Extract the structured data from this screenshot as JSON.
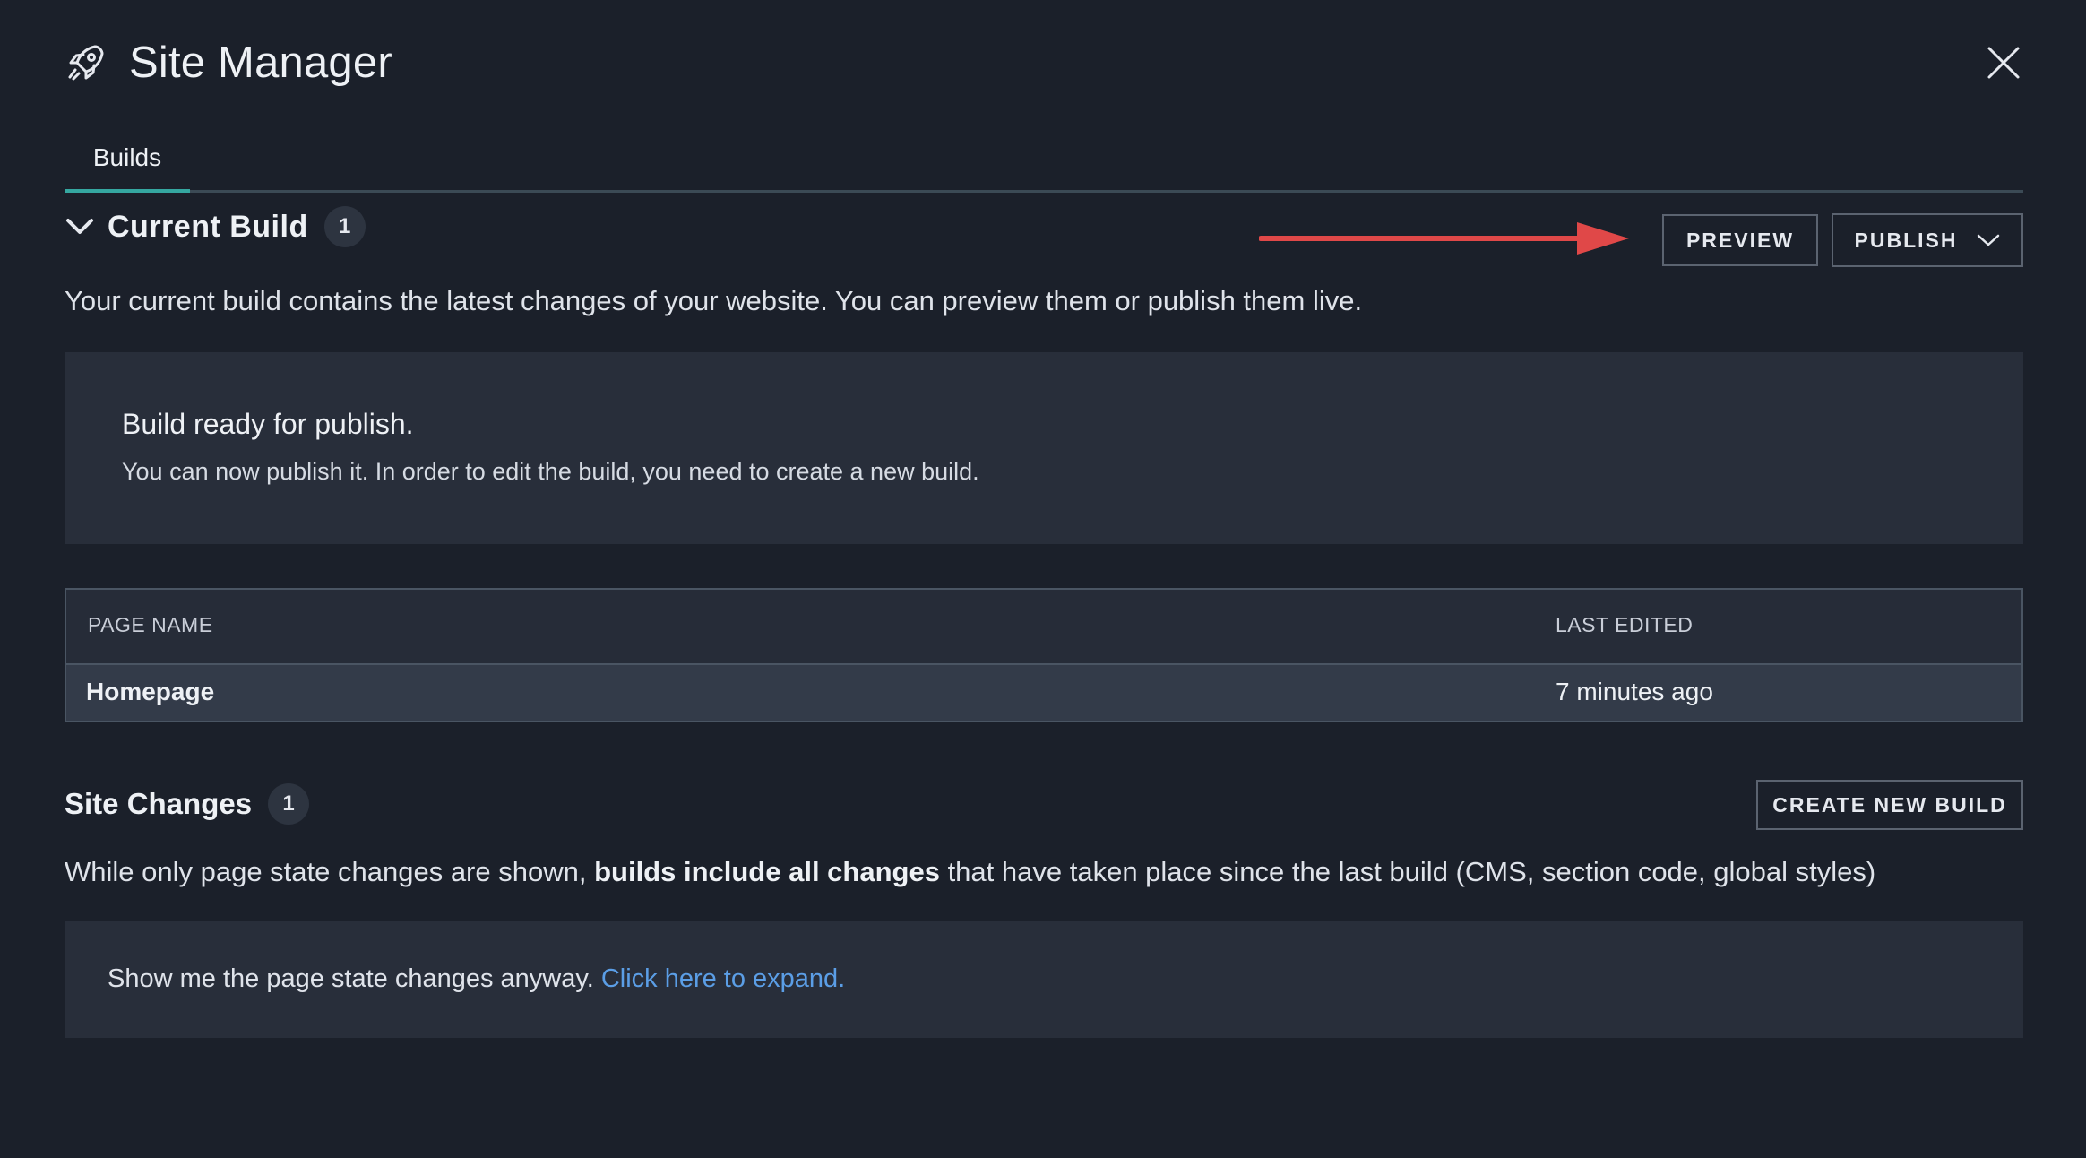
{
  "window": {
    "title": "Site Manager",
    "icon": "rocket-icon"
  },
  "tabs": [
    {
      "label": "Builds",
      "active": true
    }
  ],
  "current_build": {
    "title": "Current Build",
    "count": "1",
    "preview_label": "PREVIEW",
    "publish_label": "PUBLISH",
    "description": "Your current build contains the latest changes of your website. You can preview them or publish them live.",
    "status_card": {
      "title": "Build ready for publish.",
      "message": "You can now publish it. In order to edit the build, you need to create a new build."
    },
    "table": {
      "columns": [
        "PAGE NAME",
        "LAST EDITED"
      ],
      "rows": [
        {
          "page_name": "Homepage",
          "last_edited": "7 minutes ago"
        }
      ]
    }
  },
  "site_changes": {
    "title": "Site Changes",
    "count": "1",
    "create_label": "CREATE NEW BUILD",
    "description_pre": "While only page state changes are shown, ",
    "description_bold": "builds include all changes",
    "description_post": " that have taken place since the last build (CMS, section code, global styles)",
    "expand_text": "Show me the page state changes anyway. ",
    "expand_link": "Click here to expand."
  },
  "colors": {
    "background": "#1b202a",
    "card": "#282e3a",
    "accent_tab": "#35a7a0",
    "link": "#5b9ee6",
    "annotation_arrow": "#e04848"
  }
}
